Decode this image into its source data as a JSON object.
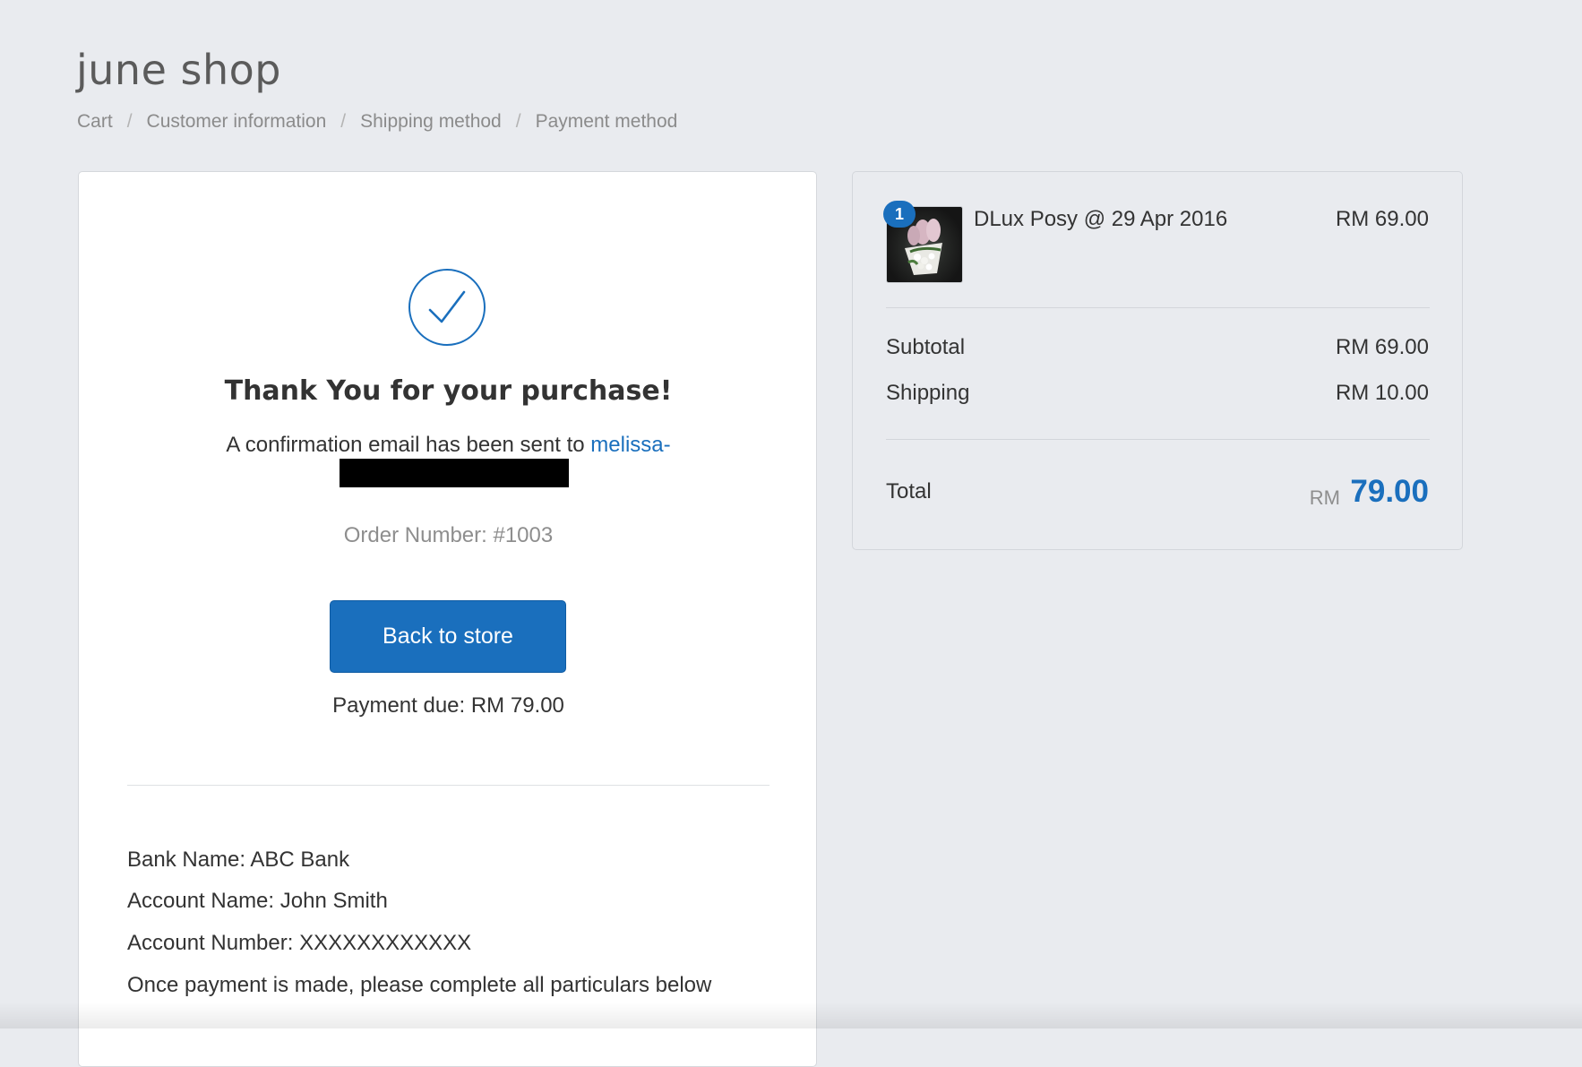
{
  "shop": {
    "name": "june shop"
  },
  "breadcrumb": {
    "items": [
      {
        "label": "Cart"
      },
      {
        "label": "Customer information"
      },
      {
        "label": "Shipping method"
      },
      {
        "label": "Payment method"
      }
    ],
    "separator": "/"
  },
  "confirmation": {
    "title": "Thank You for your purchase!",
    "email_prefix": "A confirmation email has been sent to ",
    "email_visible": "melissa-",
    "order_number": "Order Number: #1003",
    "back_button": "Back to store",
    "payment_due": "Payment due: RM 79.00",
    "icon": "check-icon"
  },
  "bank": {
    "bank_name": "Bank Name: ABC Bank",
    "account_name": "Account Name: John Smith",
    "account_number": "Account Number: XXXXXXXXXXXX",
    "instructions": "Once payment is made, please complete all particulars below"
  },
  "order_summary": {
    "item": {
      "quantity": "1",
      "name": "DLux Posy @ 29 Apr 2016",
      "price": "RM 69.00"
    },
    "subtotal_label": "Subtotal",
    "subtotal_value": "RM 69.00",
    "shipping_label": "Shipping",
    "shipping_value": "RM 10.00",
    "total_label": "Total",
    "total_currency": "RM",
    "total_amount": "79.00"
  },
  "colors": {
    "accent": "#1a6fbd",
    "background": "#e9ebef",
    "card": "#ffffff",
    "muted_text": "#8e8e8e"
  }
}
